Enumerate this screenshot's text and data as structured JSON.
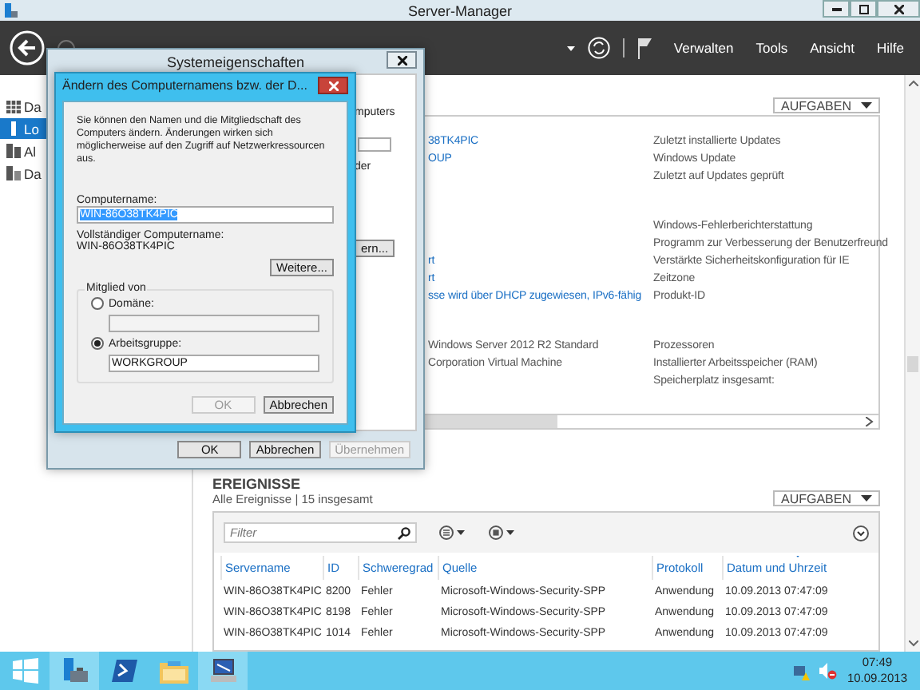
{
  "window": {
    "title": "Server-Manager"
  },
  "toolbar": {
    "menus": [
      "Verwalten",
      "Tools",
      "Ansicht",
      "Hilfe"
    ]
  },
  "sidebar": {
    "items": [
      {
        "label": "Da",
        "kind": "dashboard",
        "selected": false
      },
      {
        "label": "Lo",
        "kind": "local",
        "selected": true
      },
      {
        "label": "Al",
        "kind": "all",
        "selected": false
      },
      {
        "label": "Da",
        "kind": "files",
        "selected": false
      }
    ]
  },
  "properties": {
    "tasks_button": "AUFGABEN",
    "groups": [
      {
        "rows": [
          {
            "value": "38TK4PIC",
            "link": true,
            "label": "Zuletzt installierte Updates"
          },
          {
            "value": "OUP",
            "link": true,
            "label": "Windows Update"
          },
          {
            "label": "Zuletzt auf Updates geprüft"
          }
        ]
      },
      {
        "rows": [
          {
            "label": "Windows-Fehlerberichterstattung"
          },
          {
            "label": "Programm zur Verbesserung der Benutzerfreund"
          },
          {
            "value": "rt",
            "link": true,
            "label": "Verstärkte Sicherheitskonfiguration für IE"
          },
          {
            "value": "rt",
            "link": true,
            "label": "Zeitzone"
          },
          {
            "value": "sse wird über DHCP zugewiesen, IPv6-fähig",
            "link": true,
            "label": "Produkt-ID"
          }
        ]
      },
      {
        "rows": [
          {
            "value": "Windows Server 2012 R2 Standard",
            "link": false,
            "label": "Prozessoren"
          },
          {
            "value": "Corporation Virtual Machine",
            "link": false,
            "label": "Installierter Arbeitsspeicher (RAM)"
          },
          {
            "label": "Speicherplatz insgesamt:"
          }
        ]
      }
    ]
  },
  "events": {
    "title": "EREIGNISSE",
    "subtitle": "Alle Ereignisse | 15 insgesamt",
    "tasks_button": "AUFGABEN",
    "filter": {
      "placeholder": "Filter"
    },
    "columns": [
      {
        "label": "Servername",
        "sorted": false
      },
      {
        "label": "ID",
        "sorted": false
      },
      {
        "label": "Schweregrad",
        "sorted": false
      },
      {
        "label": "Quelle",
        "sorted": false
      },
      {
        "label": "Protokoll",
        "sorted": false
      },
      {
        "label": "Datum und Uhrzeit",
        "sorted": true
      }
    ],
    "rows": [
      [
        "WIN-86O38TK4PIC",
        "8200",
        "Fehler",
        "Microsoft-Windows-Security-SPP",
        "Anwendung",
        "10.09.2013 07:47:09"
      ],
      [
        "WIN-86O38TK4PIC",
        "8198",
        "Fehler",
        "Microsoft-Windows-Security-SPP",
        "Anwendung",
        "10.09.2013 07:47:09"
      ],
      [
        "WIN-86O38TK4PIC",
        "1014",
        "Fehler",
        "Microsoft-Windows-Security-SPP",
        "Anwendung",
        "10.09.2013 07:47:09"
      ]
    ]
  },
  "system_properties": {
    "title": "Systemeigenschaften",
    "fragments": {
      "text_top": "mputers",
      "text_mid": "der",
      "button": "ern..."
    },
    "buttons": [
      {
        "label": "OK",
        "disabled": false
      },
      {
        "label": "Abbrechen",
        "disabled": false
      },
      {
        "label": "Übernehmen",
        "disabled": true
      }
    ]
  },
  "rename_dialog": {
    "title": "Ändern des Computernamens bzw. der D...",
    "intro": "Sie können den Namen und die Mitgliedschaft des Computers ändern. Änderungen wirken sich möglicherweise auf den Zugriff auf Netzwerkressourcen aus.",
    "computer_name": {
      "label": "Computername:",
      "value": "WIN-86O38TK4PIC"
    },
    "full_name": {
      "label": "Vollständiger Computername:",
      "value": "WIN-86O38TK4PIC"
    },
    "more_button": "Weitere...",
    "member_of": {
      "legend": "Mitglied von",
      "options": [
        {
          "label": "Domäne:",
          "selected": false
        },
        {
          "label": "Arbeitsgruppe:",
          "selected": true,
          "value": "WORKGROUP"
        }
      ]
    },
    "buttons": [
      {
        "label": "OK",
        "disabled": true
      },
      {
        "label": "Abbrechen",
        "disabled": false
      }
    ]
  },
  "taskbar": {
    "apps": [
      {
        "kind": "start",
        "active": false
      },
      {
        "kind": "server",
        "active": true
      },
      {
        "kind": "powershell",
        "active": false
      },
      {
        "kind": "explorer",
        "active": false
      },
      {
        "kind": "network",
        "active": true
      }
    ],
    "clock": {
      "time": "07:49",
      "date": "10.09.2013"
    }
  }
}
